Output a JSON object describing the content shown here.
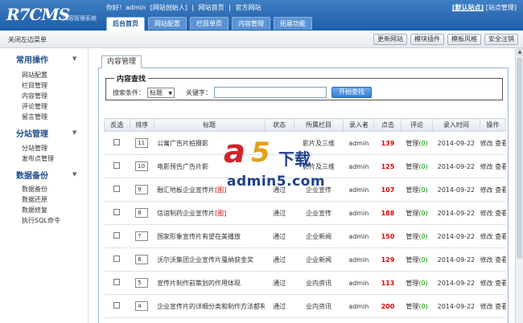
{
  "header": {
    "logo": "R7CMS",
    "logo_sub": "内容管理系统",
    "welcome": [
      "你好！admin",
      "[网站创始人]",
      "|",
      "网站首页",
      "|",
      "官方网站"
    ],
    "default_site": "[默认站点]",
    "site_manage": "[站点管理]",
    "tabs": [
      {
        "label": "后台首页",
        "active": true
      },
      {
        "label": "网站配置",
        "active": false
      },
      {
        "label": "栏目单页",
        "active": false
      },
      {
        "label": "内容管理",
        "active": false
      },
      {
        "label": "拓展功能",
        "active": false
      }
    ]
  },
  "toolbar": {
    "close_menu": "关闭左边菜单",
    "buttons": [
      "更新网站",
      "模块插件",
      "模板风格",
      "安全注销"
    ]
  },
  "sidebar": {
    "groups": [
      {
        "title": "常用操作",
        "items": [
          "网站配置",
          "栏目管理",
          "内容管理",
          "评论管理",
          "留言管理"
        ]
      },
      {
        "title": "分站管理",
        "items": [
          "分站管理",
          "发布点管理"
        ]
      },
      {
        "title": "数据备份",
        "items": [
          "数据备份",
          "数据还原",
          "数据修复",
          "执行SQL命令"
        ]
      }
    ],
    "arrow": "▼"
  },
  "main": {
    "tab_label": "内容管理",
    "search": {
      "legend": "内容查找",
      "condition_label": "搜索条件：",
      "condition_value": "标题",
      "keyword_label": "关键字：",
      "keyword_value": "",
      "button": "开始查找"
    },
    "table": {
      "headers": [
        "反选",
        "排序",
        "标题",
        "状态",
        "所属栏目",
        "录入者",
        "点击",
        "评论",
        "录入时间",
        "操作"
      ],
      "rows": [
        {
          "sort": "11",
          "title": "公寓广告片拍摄影",
          "img": "",
          "status": "",
          "column": "影片及三维",
          "author": "admin",
          "hits": "139",
          "comment": "管理",
          "cnum": "(0)",
          "date": "2014-09-22",
          "ops": "修改 查看"
        },
        {
          "sort": "10",
          "title": "电影预告广告片影",
          "img": "",
          "status": "",
          "column": "影片及三维",
          "author": "admin",
          "hits": "125",
          "comment": "管理",
          "cnum": "(0)",
          "date": "2014-09-22",
          "ops": "修改 查看"
        },
        {
          "sort": "9",
          "title": "融汇地板企业宣传片",
          "img": "[图]",
          "status": "通过",
          "column": "企业宣传",
          "author": "admin",
          "hits": "107",
          "comment": "管理",
          "cnum": "(0)",
          "date": "2014-09-22",
          "ops": "修改 查看"
        },
        {
          "sort": "8",
          "title": "信谊制药企业宣传片",
          "img": "[图]",
          "status": "通过",
          "column": "企业宣传",
          "author": "admin",
          "hits": "188",
          "comment": "管理",
          "cnum": "(0)",
          "date": "2014-09-22",
          "ops": "修改 查看"
        },
        {
          "sort": "7",
          "title": "国家形象宣传片有望在美播放",
          "img": "",
          "status": "通过",
          "column": "企业新闻",
          "author": "admin",
          "hits": "150",
          "comment": "管理",
          "cnum": "(0)",
          "date": "2014-09-22",
          "ops": "修改 查看"
        },
        {
          "sort": "6",
          "title": "沃尔沃集团企业宣传片戛纳获金奖",
          "img": "",
          "status": "通过",
          "column": "企业新闻",
          "author": "admin",
          "hits": "129",
          "comment": "管理",
          "cnum": "(0)",
          "date": "2014-09-22",
          "ops": "修改 查看"
        },
        {
          "sort": "5",
          "title": "宣传片制作前策划的作用体现",
          "img": "",
          "status": "通过",
          "column": "业内资讯",
          "author": "admin",
          "hits": "113",
          "comment": "管理",
          "cnum": "(0)",
          "date": "2014-09-22",
          "ops": "修改 查看"
        },
        {
          "sort": "4",
          "title": "企业宣传片的详细分类和制作方法都有",
          "img": "",
          "status": "通过",
          "column": "业内资讯",
          "author": "admin",
          "hits": "200",
          "comment": "管理",
          "cnum": "(0)",
          "date": "2014-09-22",
          "ops": "修改 查看"
        }
      ]
    }
  },
  "watermark": {
    "a": "a",
    "five": "5",
    "dl": "下载",
    "url": "admin5.com"
  },
  "colors": {
    "header": "#2a6ab6",
    "accent": "#1f4f8f",
    "hits": "#dd0000",
    "comment": "#009900"
  }
}
